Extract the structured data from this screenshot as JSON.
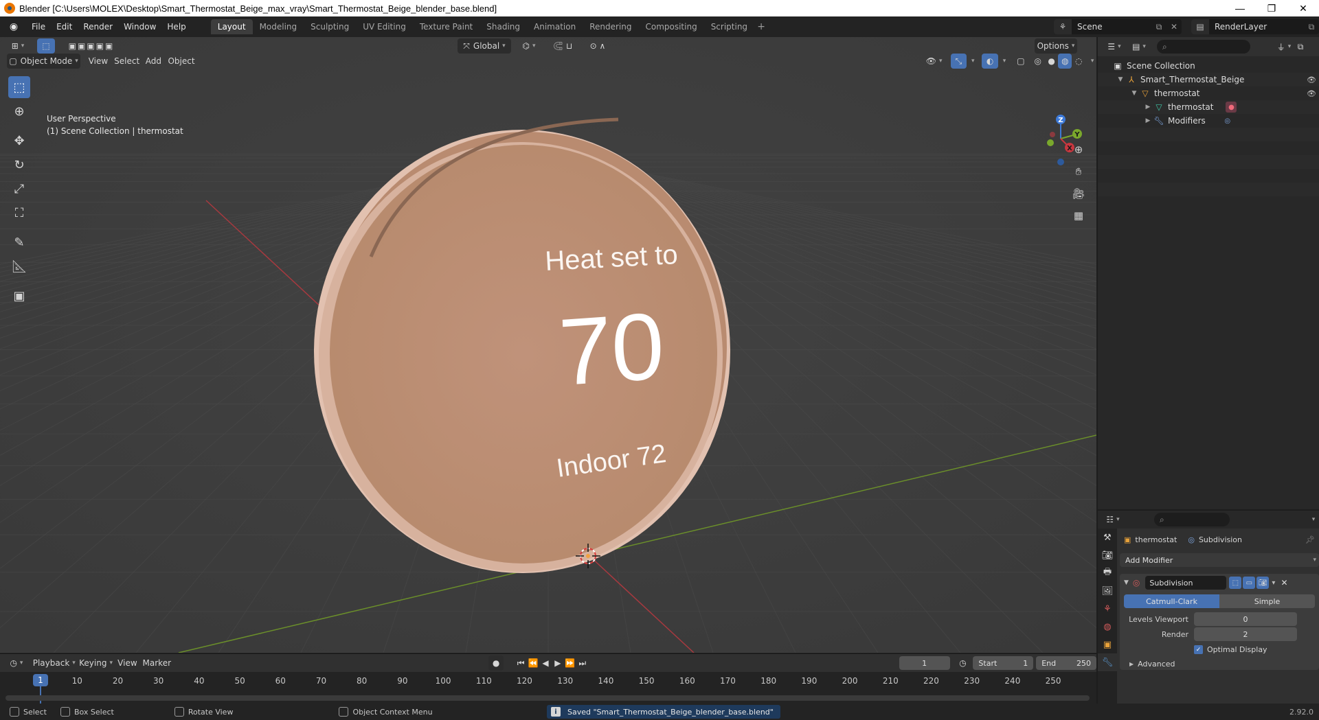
{
  "window": {
    "title": "Blender [C:\\Users\\MOLEX\\Desktop\\Smart_Thermostat_Beige_max_vray\\Smart_Thermostat_Beige_blender_base.blend]",
    "minimize": "—",
    "maximize": "❐",
    "close": "✕"
  },
  "menus": [
    "File",
    "Edit",
    "Render",
    "Window",
    "Help"
  ],
  "workspaces": [
    "Layout",
    "Modeling",
    "Sculpting",
    "UV Editing",
    "Texture Paint",
    "Shading",
    "Animation",
    "Rendering",
    "Compositing",
    "Scripting"
  ],
  "active_workspace": "Layout",
  "scene": {
    "name": "Scene",
    "view_layer": "RenderLayer"
  },
  "viewport": {
    "mode": "Object Mode",
    "menus": [
      "View",
      "Select",
      "Add",
      "Object"
    ],
    "orientation": "Global",
    "options_label": "Options",
    "overlay_line1": "User Perspective",
    "overlay_line2": "(1) Scene Collection | thermostat",
    "thermostat_heading": "Heat set to",
    "thermostat_value": "70",
    "thermostat_indoor": "Indoor 72",
    "gizmo_x": "X",
    "gizmo_y": "Y",
    "gizmo_z": "Z"
  },
  "outliner": {
    "root": "Scene Collection",
    "collection": "Smart_Thermostat_Beige",
    "object": "thermostat",
    "mesh": "thermostat",
    "modifiers": "Modifiers"
  },
  "properties": {
    "object_name": "thermostat",
    "modifier_name": "Subdivision",
    "add_modifier": "Add Modifier",
    "mod_field": "Subdivision",
    "tab_catmull": "Catmull-Clark",
    "tab_simple": "Simple",
    "levels_viewport_label": "Levels Viewport",
    "levels_viewport_value": "0",
    "render_label": "Render",
    "render_value": "2",
    "optimal_display": "Optimal Display",
    "advanced": "Advanced"
  },
  "timeline": {
    "menus": [
      "Playback",
      "Keying",
      "View",
      "Marker"
    ],
    "current_frame": "1",
    "start_label": "Start",
    "start_value": "1",
    "end_label": "End",
    "end_value": "250",
    "ticks": [
      "10",
      "20",
      "30",
      "40",
      "50",
      "60",
      "70",
      "80",
      "90",
      "100",
      "110",
      "120",
      "130",
      "140",
      "150",
      "160",
      "170",
      "180",
      "190",
      "200",
      "210",
      "220",
      "230",
      "240",
      "250"
    ],
    "cursor_label": "1"
  },
  "statusbar": {
    "select": "Select",
    "box_select": "Box Select",
    "rotate_view": "Rotate View",
    "context_menu": "Object Context Menu",
    "saved_message": "Saved \"Smart_Thermostat_Beige_blender_base.blend\"",
    "version": "2.92.0"
  },
  "colors": {
    "accent": "#4772b3",
    "thermostat_face": "#bd8f72",
    "thermostat_rim": "#e2c1b0",
    "axis_x": "#c8373f",
    "axis_y": "#7aa82c",
    "axis_z": "#3d7ad8"
  }
}
